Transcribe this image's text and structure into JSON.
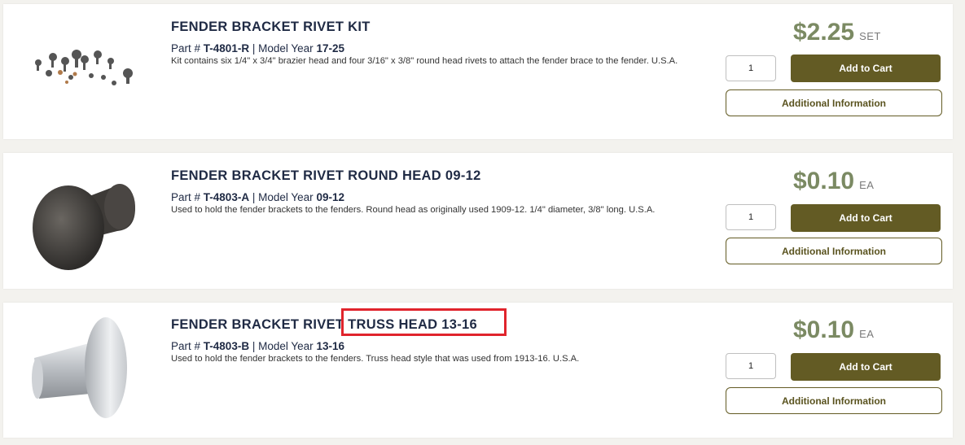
{
  "products": [
    {
      "title": "FENDER BRACKET RIVET KIT",
      "part_label": "Part #",
      "part_number": "T-4801-R",
      "separator": "|",
      "model_label": "Model Year",
      "model_year": "17-25",
      "description": "Kit contains six 1/4\" x 3/4\" brazier head and four 3/16\" x 3/8\" round head rivets to attach the fender brace to the fender. U.S.A.",
      "price": "$2.25",
      "unit": "SET",
      "quantity": "1",
      "add_to_cart_label": "Add to Cart",
      "info_label": "Additional Information"
    },
    {
      "title": "FENDER BRACKET RIVET ROUND HEAD 09-12",
      "part_label": "Part #",
      "part_number": "T-4803-A",
      "separator": "|",
      "model_label": "Model Year",
      "model_year": "09-12",
      "description": "Used to hold the fender brackets to the fenders. Round head as originally used 1909-12. 1/4\" diameter, 3/8\" long. U.S.A.",
      "price": "$0.10",
      "unit": "EA",
      "quantity": "1",
      "add_to_cart_label": "Add to Cart",
      "info_label": "Additional Information"
    },
    {
      "title": "FENDER BRACKET RIVET TRUSS HEAD 13-16",
      "part_label": "Part #",
      "part_number": "T-4803-B",
      "separator": "|",
      "model_label": "Model Year",
      "model_year": "13-16",
      "description": "Used to hold the fender brackets to the fenders. Truss head style that was used from 1913-16. U.S.A.",
      "price": "$0.10",
      "unit": "EA",
      "quantity": "1",
      "add_to_cart_label": "Add to Cart",
      "info_label": "Additional Information"
    }
  ],
  "colors": {
    "title": "#1f2a44",
    "price": "#7b8a63",
    "cart_button": "#635b24",
    "highlight_box": "#e0242c"
  }
}
